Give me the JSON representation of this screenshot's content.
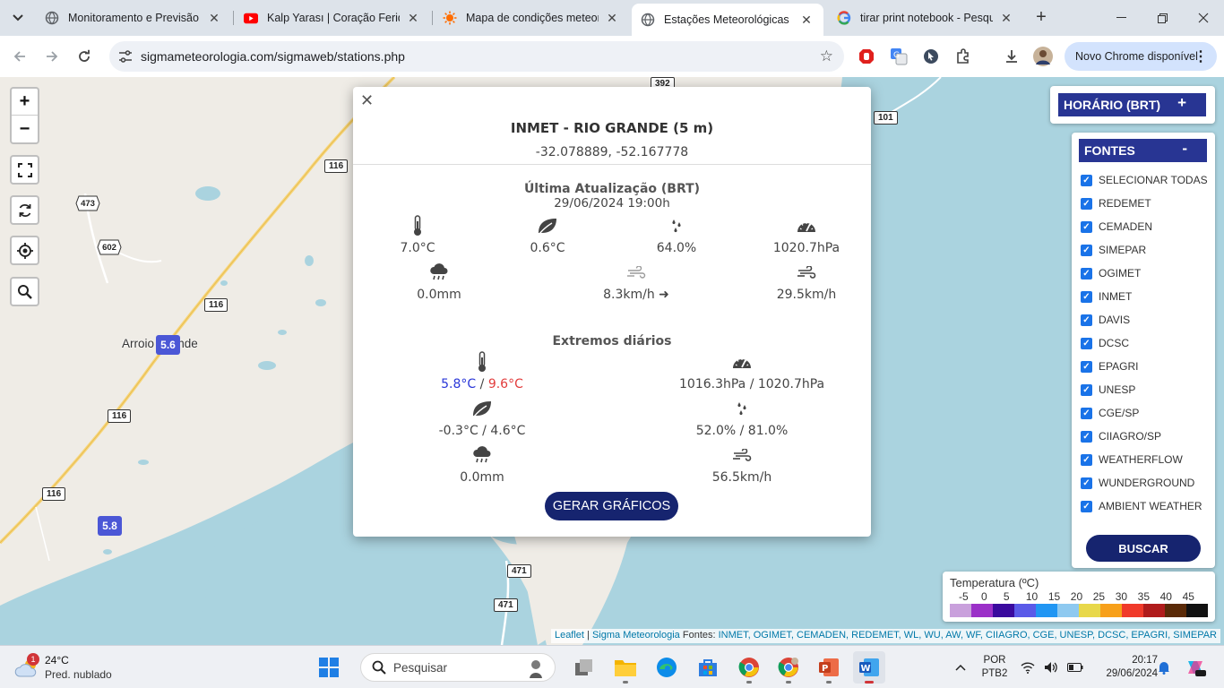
{
  "browser": {
    "tabs": [
      {
        "title": "Monitoramento e Previsão -",
        "active": false
      },
      {
        "title": "Kalp Yarası | Coração Ferido",
        "active": false
      },
      {
        "title": "Mapa de condições meteoro",
        "active": false
      },
      {
        "title": "Estações Meteorológicas",
        "active": true
      },
      {
        "title": "tirar print notebook - Pesqui",
        "active": false
      }
    ],
    "url": "sigmameteorologia.com/sigmaweb/stations.php",
    "update_label": "Novo Chrome disponível"
  },
  "map": {
    "city": "Arroio Grande",
    "shields": [
      "392",
      "101",
      "116",
      "473",
      "602",
      "116",
      "116",
      "116",
      "471",
      "471"
    ],
    "markers": [
      "5.6",
      "5.8"
    ]
  },
  "popup": {
    "title": "INMET - RIO GRANDE (5 m)",
    "coords": "-32.078889, -52.167778",
    "update_title": "Última Atualização (BRT)",
    "update_date": "29/06/2024 19:00h",
    "current": {
      "temp": "7.0°C",
      "dew": "0.6°C",
      "humidity": "64.0%",
      "pressure": "1020.7hPa",
      "rain": "0.0mm",
      "wind": "8.3km/h",
      "gust": "29.5km/h"
    },
    "extremes_title": "Extremos diários",
    "extremes": {
      "temp_min": "5.8°C",
      "temp_sep": " / ",
      "temp_max": "9.6°C",
      "pressure": "1016.3hPa / 1020.7hPa",
      "dew": "-0.3°C / 4.6°C",
      "humidity": "52.0% / 81.0%",
      "rain": "0.0mm",
      "gust": "56.5km/h"
    },
    "button": "GERAR GRÁFICOS"
  },
  "horario": {
    "label": "HORÁRIO (BRT)",
    "toggle": "+"
  },
  "fontes": {
    "label": "FONTES",
    "toggle": "-",
    "items": [
      "SELECIONAR TODAS",
      "REDEMET",
      "CEMADEN",
      "SIMEPAR",
      "OGIMET",
      "INMET",
      "DAVIS",
      "DCSC",
      "EPAGRI",
      "UNESP",
      "CGE/SP",
      "CIIAGRO/SP",
      "WEATHERFLOW",
      "WUNDERGROUND",
      "AMBIENT WEATHER"
    ],
    "button": "BUSCAR"
  },
  "legend": {
    "title": "Temperatura (ºC)",
    "ticks": [
      "-5",
      "0",
      "5",
      "10",
      "15",
      "20",
      "25",
      "30",
      "35",
      "40",
      "45"
    ],
    "colors": [
      "#c9a0dc",
      "#9b30c8",
      "#3a0a9e",
      "#5a5ae8",
      "#2196f3",
      "#8ec9f0",
      "#e8d84a",
      "#f7a01a",
      "#f03a2a",
      "#b01c1c",
      "#5a2a08",
      "#111111"
    ]
  },
  "attribution": {
    "leaflet": "Leaflet",
    "sep": " | ",
    "sigma": "Sigma Meteorologia",
    "fontes_label": " Fontes: ",
    "fontes_list": "INMET, OGIMET, CEMADEN, REDEMET, WL, WU, AW, WF, CIIAGRO, CGE, UNESP, DCSC, EPAGRI, SIMEPAR"
  },
  "taskbar": {
    "weather_temp": "24°C",
    "weather_desc": "Pred. nublado",
    "weather_badge": "1",
    "search_placeholder": "Pesquisar",
    "lang": "POR",
    "layout": "PTB2",
    "time": "20:17",
    "date": "29/06/2024"
  }
}
